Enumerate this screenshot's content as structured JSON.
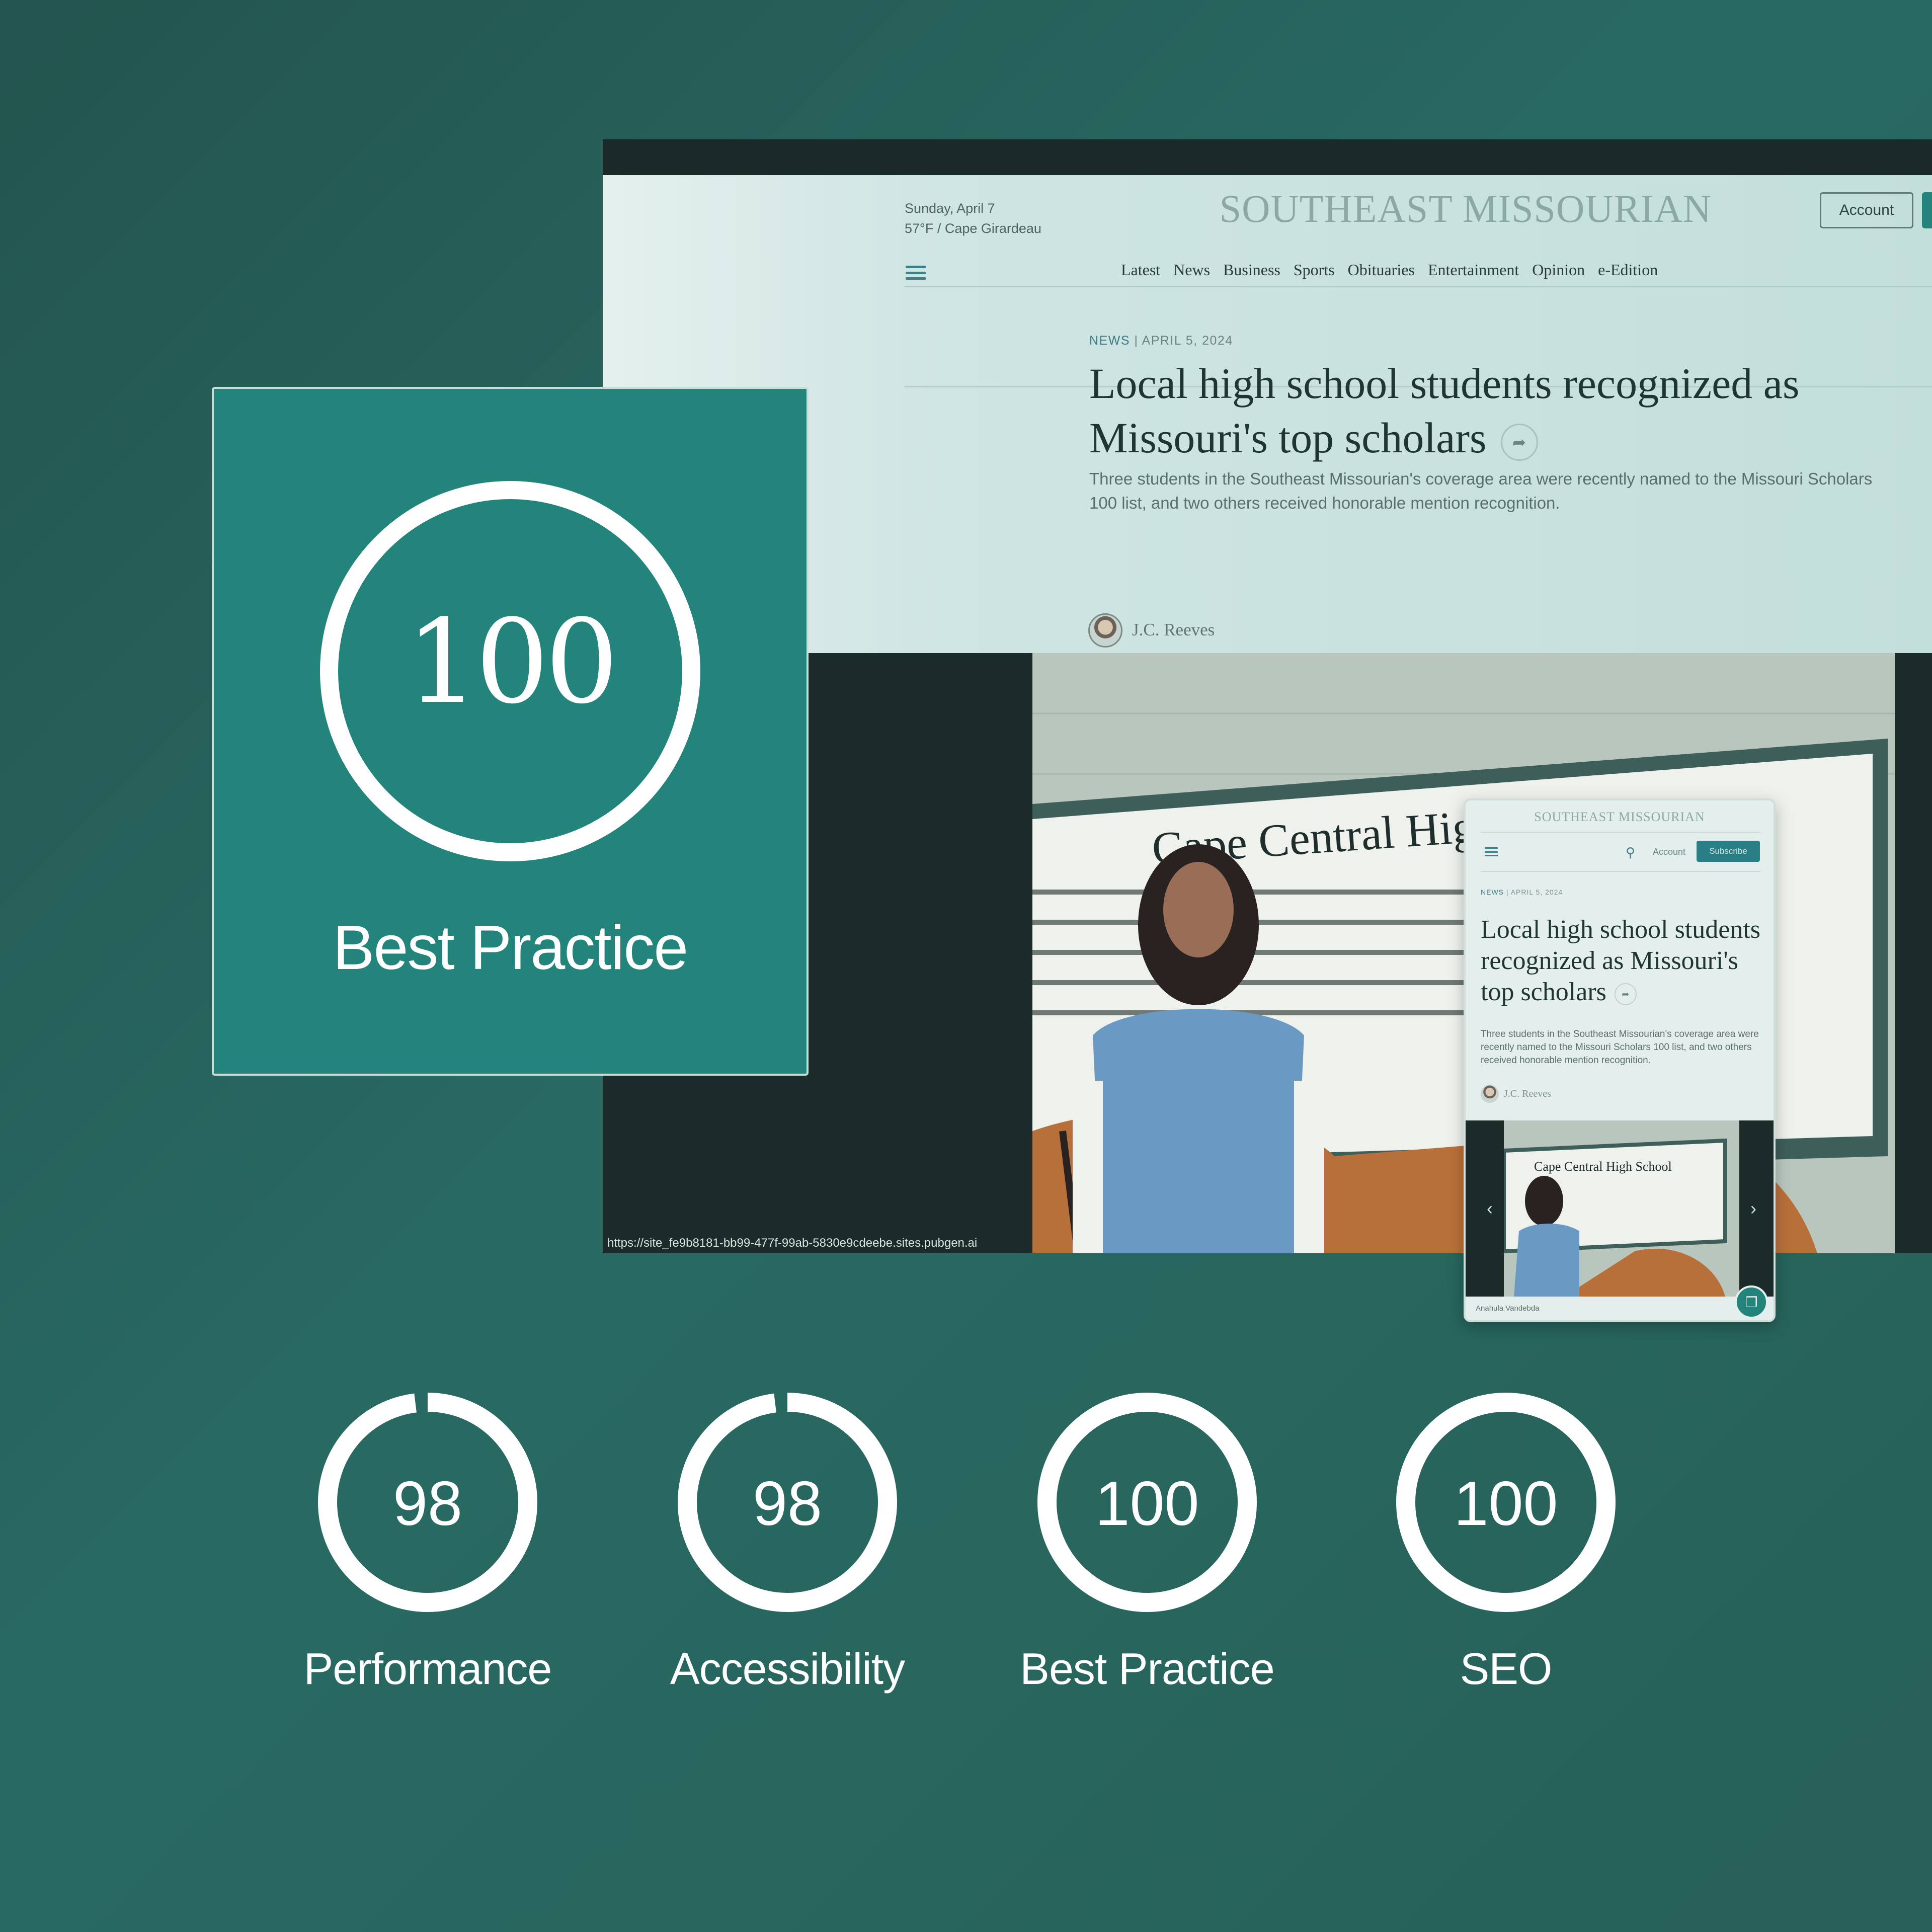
{
  "browser": {
    "status_url": "https://site_fe9b8181-bb99-477f-99ab-5830e9cdeebe.sites.pubgen.ai",
    "header": {
      "date": "Sunday, April 7",
      "weather": "57°F / Cape Girardeau",
      "logo": "SOUTHEAST MISSOURIAN",
      "account_label": "Account",
      "menu_icon": "hamburger-icon",
      "nav": [
        "Latest",
        "News",
        "Business",
        "Sports",
        "Obituaries",
        "Entertainment",
        "Opinion",
        "e-Edition"
      ]
    },
    "article": {
      "category": "NEWS",
      "separator": "|",
      "date": "APRIL 5, 2024",
      "title": "Local high school students recognized as Missouri's top scholars",
      "share_icon": "share-arrow-icon",
      "dek": "Three students in the Southeast Missourian's coverage area were recently named to the Missouri Scholars 100 list, and two others received honorable mention recognition.",
      "author": "J.C. Reeves"
    },
    "photo": {
      "sign_text": "Cape Central High S"
    }
  },
  "featured_score": {
    "value": "100",
    "score": 100,
    "label": "Best Practice"
  },
  "mobile": {
    "logo": "SOUTHEAST MISSOURIAN",
    "account_label": "Account",
    "subscribe_label": "Subscribe",
    "category": "NEWS",
    "separator": "|",
    "date": "APRIL 5, 2024",
    "title": "Local high school students recognized as Missouri's top scholars",
    "dek": "Three students in the Southeast Missourian's coverage area were recently named to the Missouri Scholars 100 list, and two others received honorable mention recognition.",
    "author": "J.C. Reeves",
    "photo_sign": "Cape Central High School",
    "caption": "Anahula Vandebda",
    "prev_icon": "chevron-left-icon",
    "next_icon": "chevron-right-icon"
  },
  "scores": [
    {
      "value": "98",
      "score": 98,
      "label": "Performance"
    },
    {
      "value": "98",
      "score": 98,
      "label": "Accessibility"
    },
    {
      "value": "100",
      "score": 100,
      "label": "Best Practice"
    },
    {
      "value": "100",
      "score": 100,
      "label": "SEO"
    }
  ],
  "colors": {
    "background": "#286a62",
    "accent": "#23847c",
    "dark": "#1b2b2a",
    "ring": "#ffffff"
  }
}
